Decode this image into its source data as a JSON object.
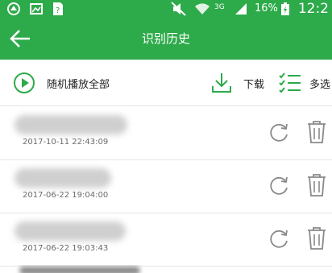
{
  "status_bar": {
    "battery_percent": "16%",
    "time": "12:2",
    "network": "3G"
  },
  "app_bar": {
    "title": "识别历史"
  },
  "toolbar": {
    "shuffle_play_label": "随机播放全部",
    "download_label": "下载",
    "multi_select_label": "多选"
  },
  "history": {
    "items": [
      {
        "title": "",
        "timestamp": "2017-10-11 22:43:09"
      },
      {
        "title": "",
        "timestamp": "2017-06-22 19:04:00"
      },
      {
        "title": "",
        "timestamp": "2017-06-22 19:03:43"
      }
    ]
  },
  "colors": {
    "brand_green": "#2daa4a",
    "icon_green": "#2daa4a",
    "icon_gray": "#8a8a8a"
  },
  "icons": {
    "back": "arrow-left-icon",
    "shuffle_play": "play-circle-icon",
    "download": "download-icon",
    "multi_select": "checklist-icon",
    "refresh": "refresh-icon",
    "delete": "trash-icon"
  }
}
